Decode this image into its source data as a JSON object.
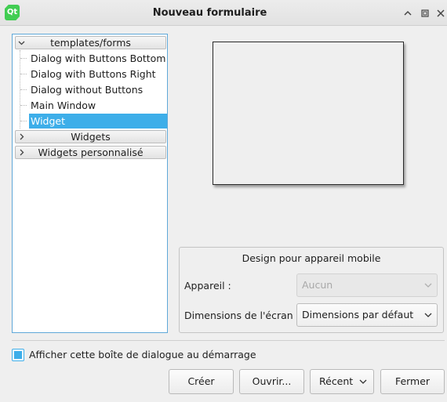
{
  "window": {
    "title": "Nouveau formulaire",
    "icon": "qt-logo-icon",
    "icon_text": "Qt",
    "controls": [
      "keep-above-icon",
      "maximize-icon",
      "close-icon"
    ]
  },
  "templates": {
    "groups": [
      {
        "label": "templates/forms",
        "expanded": true,
        "items": [
          {
            "label": "Dialog with Buttons Bottom",
            "selected": false
          },
          {
            "label": "Dialog with Buttons Right",
            "selected": false
          },
          {
            "label": "Dialog without Buttons",
            "selected": false
          },
          {
            "label": "Main Window",
            "selected": false
          },
          {
            "label": "Widget",
            "selected": true
          }
        ]
      },
      {
        "label": "Widgets",
        "expanded": false
      },
      {
        "label": "Widgets personnalisé",
        "expanded": false
      }
    ]
  },
  "mobile_design": {
    "title": "Design pour appareil mobile",
    "device_label": "Appareil :",
    "device_value": "Aucun",
    "device_enabled": false,
    "screen_label": "Dimensions de l'écran :",
    "screen_value": "Dimensions par défaut"
  },
  "startup_checkbox": {
    "label": "Afficher cette boîte de dialogue au démarrage",
    "checked": true
  },
  "buttons": {
    "create": "Créer",
    "open": "Ouvrir...",
    "recent": "Récent",
    "close": "Fermer"
  },
  "colors": {
    "accent": "#3daee9",
    "window_bg": "#efefef",
    "qt_green": "#41cd52"
  }
}
